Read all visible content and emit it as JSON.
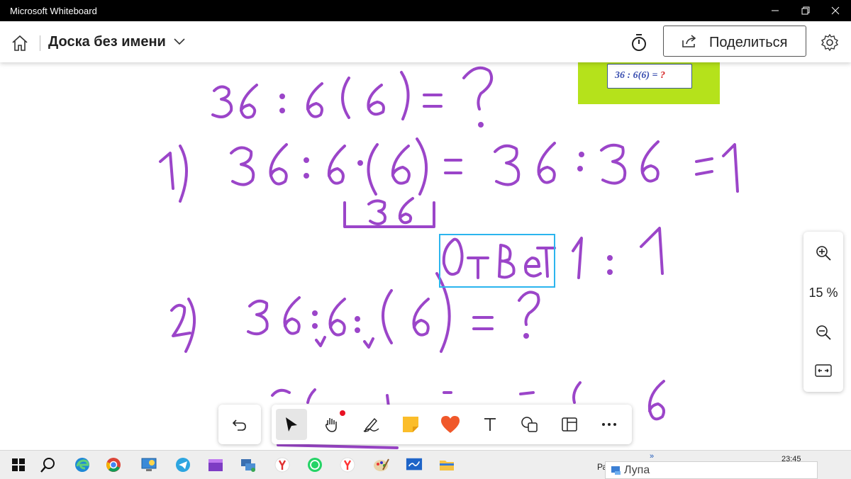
{
  "window": {
    "title": "Microsoft Whiteboard"
  },
  "header": {
    "board_name": "Доска без имени",
    "share_label": "Поделиться"
  },
  "canvas": {
    "inserted_image_expr_main": "36 : 6(6) = ",
    "inserted_image_expr_q": "?",
    "colors": {
      "ink": "#9b45c9",
      "answer_box": "#2bb5ee",
      "image_bg": "#b5e21b"
    }
  },
  "zoom": {
    "value": "15 %"
  },
  "toolbar": {
    "tools": [
      "undo",
      "select",
      "pan",
      "pen",
      "sticky-note",
      "reaction",
      "text",
      "shapes",
      "template",
      "more"
    ],
    "selected": "select"
  },
  "taskbar": {
    "tray_label": "Ра",
    "clock": "23:45",
    "magnifier_label": "Лупа",
    "apps": [
      "windows",
      "search",
      "edge",
      "chrome",
      "control-panel",
      "telegram",
      "video-editor",
      "network",
      "yandex",
      "whatsapp",
      "yandex-browser",
      "paint",
      "whiteboard",
      "explorer"
    ]
  }
}
